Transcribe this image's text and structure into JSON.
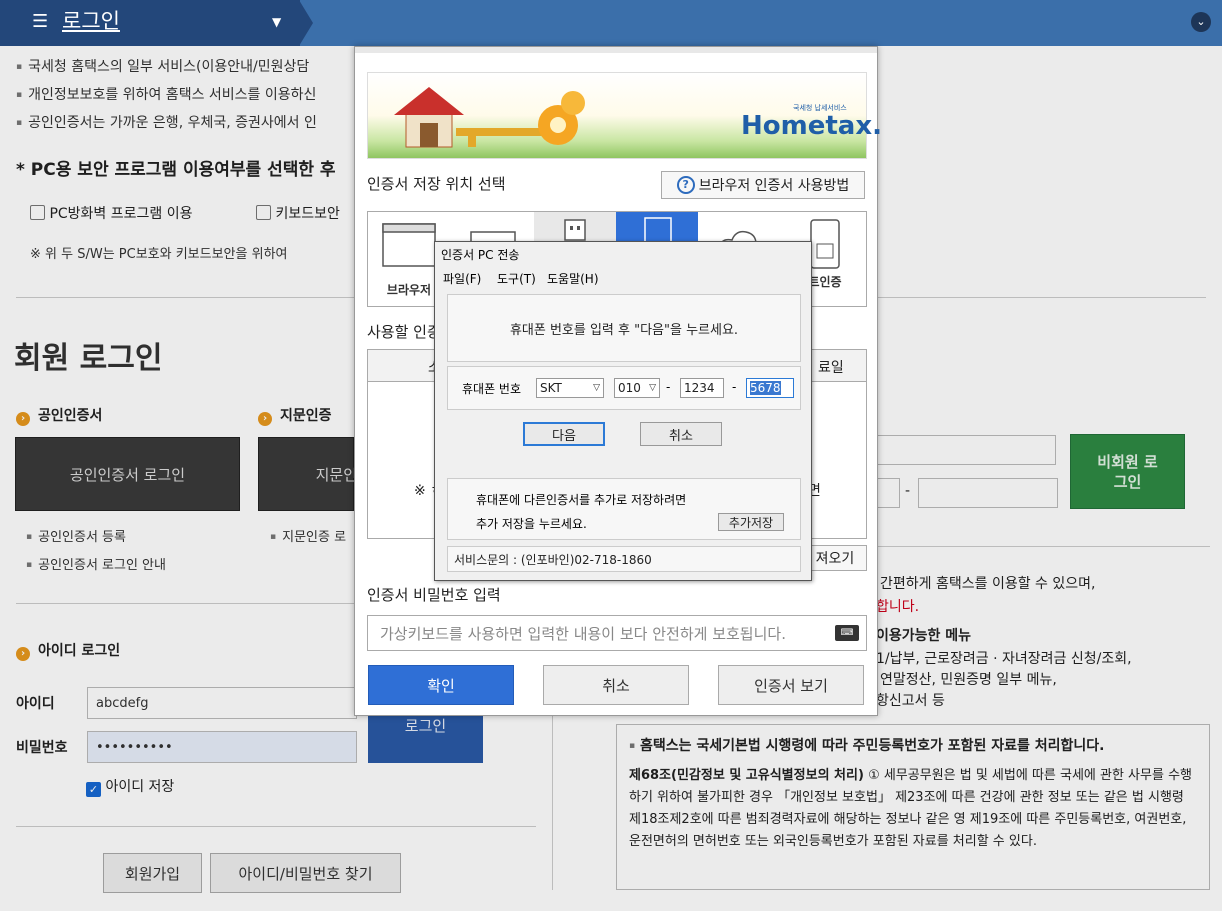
{
  "header": {
    "title": "로그인",
    "menu_icon": "menu-icon",
    "caret": "▼",
    "right_icon": "chevron-down-icon"
  },
  "notice": [
    "국세청 홈택스의 일부 서비스(이용안내/민원상담",
    "개인정보보호를 위하여 홈택스 서비스를 이용하신",
    "공인인증서는 가까운 은행, 우체국, 증권사에서 인"
  ],
  "security": {
    "title": "* PC용 보안 프로그램 이용여부를 선택한 후",
    "opt1": "PC방화벽 프로그램 이용",
    "opt2": "키보드보안",
    "note": "※ 위 두 S/W는 PC보호와 키보드보안을 위하여"
  },
  "member_login": {
    "title": "회원 로그인",
    "cert_title": "공인인증서",
    "cert_btn": "공인인증서 로그인",
    "finger_title": "지문인증",
    "finger_btn": "지문인",
    "cert_links": [
      "공인인증서 등록",
      "공인인증서 로그인 안내"
    ],
    "finger_link": "지문인증 로"
  },
  "id_login": {
    "title": "아이디 로그인",
    "id_label": "아이디",
    "id_value": "abcdefg",
    "pw_label": "비밀번호",
    "pw_value": "••••••••••",
    "login_btn": "로그인",
    "save_id": "아이디 저장",
    "signup_btn": "회원가입",
    "find_btn": "아이디/비밀번호 찾기"
  },
  "right": {
    "nonmember_btn": "비회원 로그인",
    "dash": "-",
    "text1": "간편하게 홈택스를 이용할 수 있으며,",
    "text2": "합니다.",
    "menu_title": "이용가능한 메뉴",
    "menu1": "1/납부, 근로장려금 · 자녀장려금 신청/조회,",
    "menu2": "연말정산, 민원증명 일부 메뉴,",
    "menu3": "항신고서 등",
    "box_title": "홈택스는 국세기본법 시행령에 따라 주민등록번호가 포함된 자료를 처리합니다.",
    "box_bold": "제68조(민감정보 및 고유식별정보의 처리)",
    "box_text": "① 세무공무원은 법 및 세법에 따른 국세에 관한 사무를 수행하기 위하여 불가피한 경우 「개인정보 보호법」 제23조에 따른 건강에 관한 정보 또는 같은 법 시행령 제18조제2호에 따른 범죄경력자료에 해당하는 정보나 같은 영 제19조에 따른 주민등록번호, 여권번호, 운전면허의 면허번호 또는 외국인등록번호가 포함된 자료를 처리할 수 있다."
  },
  "modal": {
    "banner_logo": "Hometax.",
    "banner_sub": "국세청 납세서비스",
    "storage_title": "인증서 저장 위치 선택",
    "howto_btn": "브라우저 인증서 사용방법",
    "locations": [
      "브라우저",
      "",
      "",
      "",
      "",
      "트인증"
    ],
    "select_title": "사용할 인증",
    "col_first": "소",
    "col_last": "료일",
    "table_note": "※ ㅎ",
    "table_note_right": "면",
    "view_btn": "져오기",
    "pw_title": "인증서 비밀번호 입력",
    "pw_placeholder": "가상키보드를 사용하면 입력한 내용이 보다 안전하게 보호됩니다.",
    "ok_btn": "확인",
    "cancel_btn": "취소",
    "view_cert_btn": "인증서 보기"
  },
  "pc_window": {
    "title": "인증서 PC 전송",
    "menu": [
      "파일(F)",
      "도구(T)",
      "도움말(H)"
    ],
    "message": "휴대폰 번호를 입력 후 \"다음\"을 누르세요.",
    "phone_label": "휴대폰 번호",
    "carrier": "SKT",
    "prefix": "010",
    "mid": "1234",
    "last": "5678",
    "dash": "-",
    "next_btn": "다음",
    "cancel_btn": "취소",
    "extra_text1": "휴대폰에 다른인증서를 추가로 저장하려면",
    "extra_text2": "추가 저장을 누르세요.",
    "extra_btn": "추가저장",
    "footer": "서비스문의 : (인포바인)02-718-1860"
  },
  "colors": {
    "header": "#3b6faa",
    "header_dark": "#23477a",
    "primary": "#2f6fd6",
    "green": "#2e8a44",
    "orange": "#e8981e",
    "red": "#d0021b"
  }
}
